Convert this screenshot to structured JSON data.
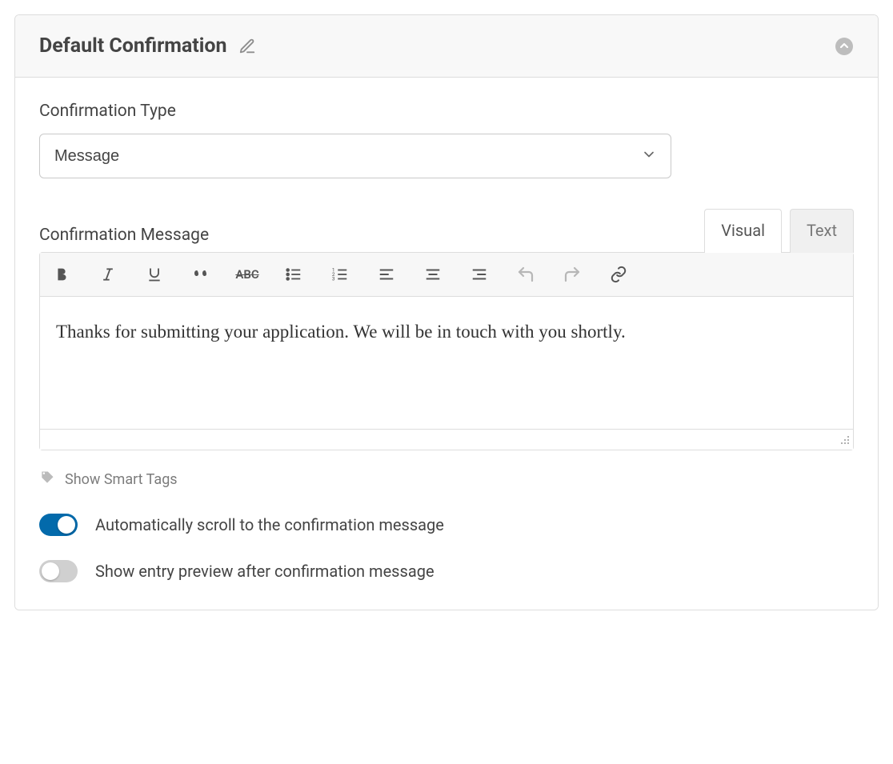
{
  "header": {
    "title": "Default Confirmation"
  },
  "fields": {
    "type_label": "Confirmation Type",
    "type_value": "Message",
    "message_label": "Confirmation Message",
    "message_value": "Thanks for submitting your application. We will be in touch with you shortly."
  },
  "editor": {
    "tabs": {
      "visual": "Visual",
      "text": "Text",
      "active": "visual"
    }
  },
  "smart_tags": {
    "label": "Show Smart Tags"
  },
  "toggles": {
    "scroll": {
      "label": "Automatically scroll to the confirmation message",
      "on": true
    },
    "preview": {
      "label": "Show entry preview after confirmation message",
      "on": false
    }
  }
}
